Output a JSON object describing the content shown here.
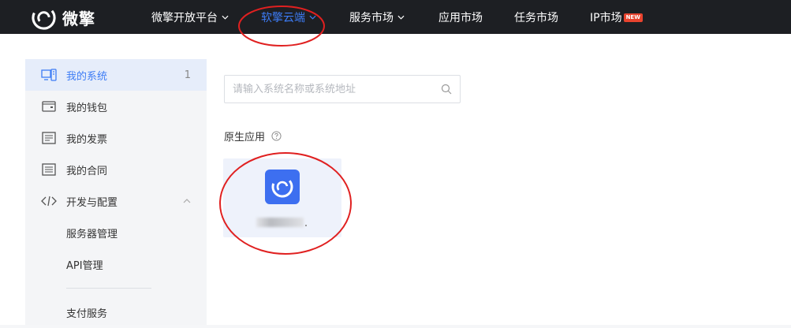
{
  "brand": {
    "name": "微擎"
  },
  "nav": {
    "items": [
      {
        "label": "微擎开放平台",
        "has_dropdown": true
      },
      {
        "label": "软擎云端",
        "has_dropdown": true,
        "active": true
      },
      {
        "label": "服务市场",
        "has_dropdown": true
      },
      {
        "label": "应用市场",
        "has_dropdown": false
      },
      {
        "label": "任务市场",
        "has_dropdown": false
      },
      {
        "label": "IP市场",
        "has_dropdown": false,
        "badge": "NEW"
      }
    ]
  },
  "sidebar": {
    "items": [
      {
        "label": "我的系统",
        "count": "1",
        "icon": "system-icon",
        "active": true
      },
      {
        "label": "我的钱包",
        "icon": "wallet-icon"
      },
      {
        "label": "我的发票",
        "icon": "invoice-icon"
      },
      {
        "label": "我的合同",
        "icon": "contract-icon"
      },
      {
        "label": "开发与配置",
        "icon": "code-icon",
        "expanded": true
      },
      {
        "label": "服务器管理",
        "sub": true
      },
      {
        "label": "API管理",
        "sub": true
      },
      {
        "label": "支付服务",
        "sub": true
      }
    ]
  },
  "search": {
    "placeholder": "请输入系统名称或系统地址",
    "value": ""
  },
  "section": {
    "title": "原生应用"
  },
  "colors": {
    "accent": "#3d7cf5",
    "topbar": "#1d1f23",
    "annotation": "#e02020",
    "badge": "#e8432e"
  }
}
